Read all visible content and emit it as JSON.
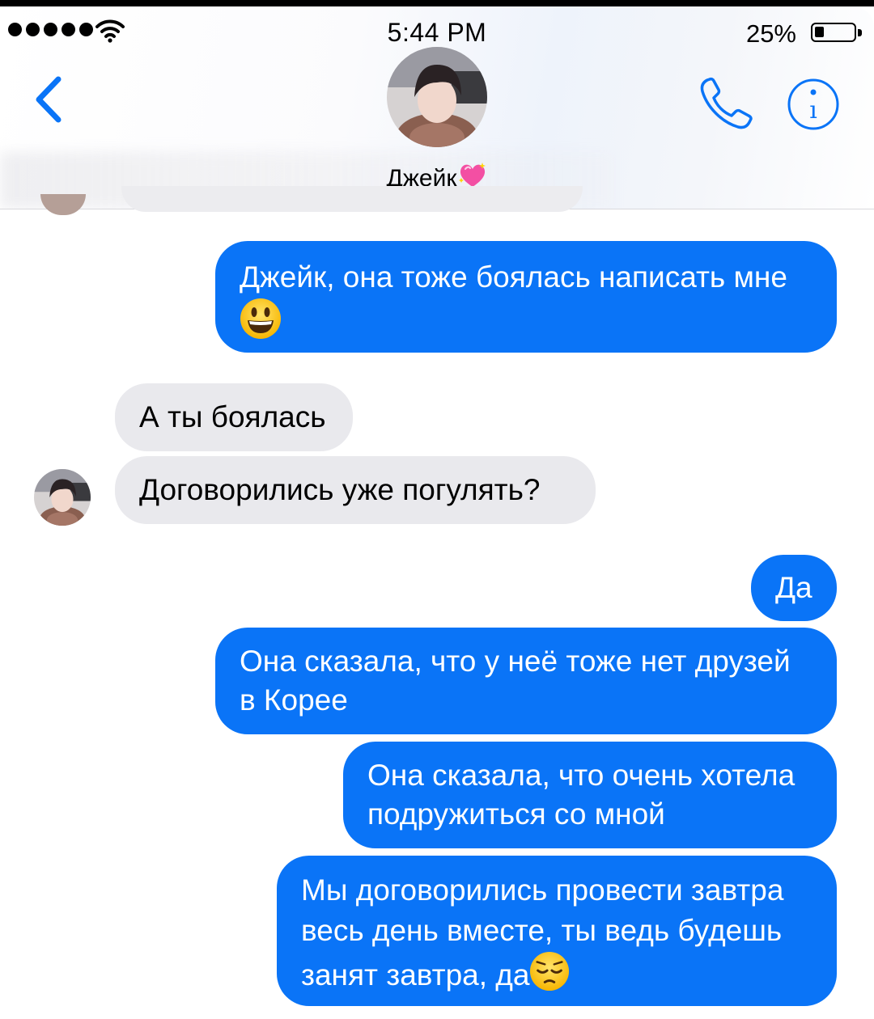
{
  "status_bar": {
    "time": "5:44 PM",
    "battery_percent": "25%",
    "battery_level": 0.25
  },
  "header": {
    "back_icon": "chevron-left-icon",
    "contact_name": "Джейк",
    "name_emoji": "sparkling-heart-icon",
    "call_icon": "phone-icon",
    "info_icon": "info-icon",
    "accent_color": "#0a74f7"
  },
  "messages": [
    {
      "direction": "outgoing",
      "lines": [
        "Джейк, она тоже боялась написать мне"
      ],
      "emoji": "grinning-face-icon"
    },
    {
      "direction": "incoming",
      "lines": [
        "А ты боялась"
      ]
    },
    {
      "direction": "incoming",
      "lines": [
        "Договорились уже погулять?"
      ]
    },
    {
      "direction": "outgoing",
      "lines": [
        "Да"
      ]
    },
    {
      "direction": "outgoing",
      "lines": [
        "Она сказала, что у неё тоже нет друзей",
        "в Корее"
      ]
    },
    {
      "direction": "outgoing",
      "lines": [
        "Она сказала, что очень хотела",
        "подружиться со мной"
      ]
    },
    {
      "direction": "outgoing",
      "lines": [
        "Мы договорились провести завтра",
        "весь день вместе, ты ведь будешь",
        "занят завтра, да"
      ],
      "emoji": "pensive-face-icon"
    }
  ],
  "colors": {
    "outgoing_bubble": "#0a74f7",
    "incoming_bubble": "#e9e9ed"
  }
}
